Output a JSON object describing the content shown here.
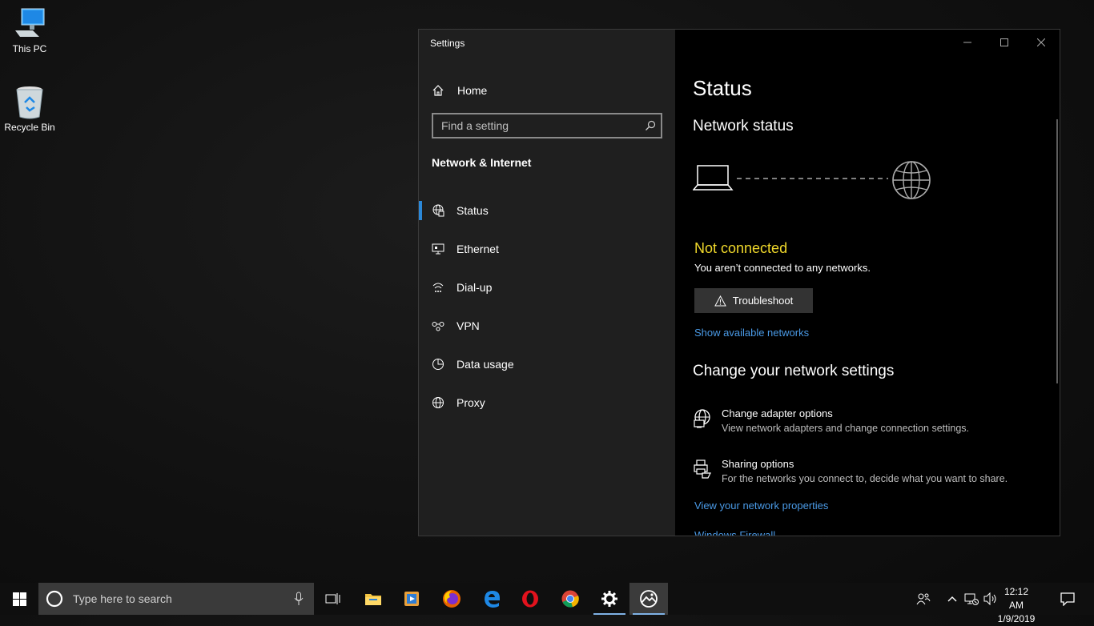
{
  "desktop": {
    "icons": [
      {
        "label": "This PC"
      },
      {
        "label": "Recycle Bin"
      }
    ]
  },
  "window": {
    "title": "Settings",
    "nav": {
      "home": "Home",
      "search_placeholder": "Find a setting",
      "section": "Network & Internet",
      "items": [
        {
          "label": "Status",
          "icon": "globe-status-icon",
          "active": true
        },
        {
          "label": "Ethernet",
          "icon": "ethernet-icon"
        },
        {
          "label": "Dial-up",
          "icon": "dialup-icon"
        },
        {
          "label": "VPN",
          "icon": "vpn-icon"
        },
        {
          "label": "Data usage",
          "icon": "pie-chart-icon"
        },
        {
          "label": "Proxy",
          "icon": "globe-icon"
        }
      ]
    },
    "content": {
      "title": "Status",
      "network_status_heading": "Network status",
      "connection_state": "Not connected",
      "connection_message": "You aren’t connected to any networks.",
      "troubleshoot": "Troubleshoot",
      "show_networks": "Show available networks",
      "change_heading": "Change your network settings",
      "options": [
        {
          "title": "Change adapter options",
          "desc": "View network adapters and change connection settings.",
          "icon": "adapter-icon"
        },
        {
          "title": "Sharing options",
          "desc": "For the networks you connect to, decide what you want to share.",
          "icon": "sharing-icon"
        }
      ],
      "view_properties": "View your network properties",
      "windows_firewall": "Windows Firewall"
    },
    "colors": {
      "accent": "#2b88d8",
      "link": "#4a9ae6",
      "warning": "#f1d92b"
    }
  },
  "taskbar": {
    "search_placeholder": "Type here to search",
    "clock_time": "12:12 AM",
    "clock_date": "1/9/2019",
    "apps": [
      "task-view",
      "file-explorer",
      "media-player",
      "firefox",
      "edge",
      "opera",
      "chrome",
      "settings",
      "photos"
    ]
  }
}
